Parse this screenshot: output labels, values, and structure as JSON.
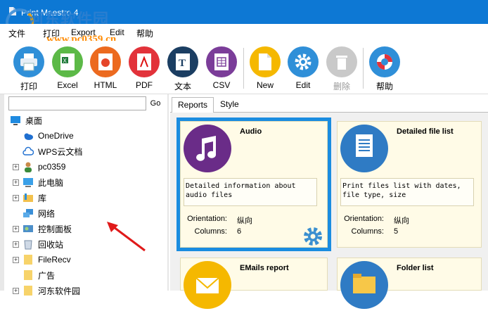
{
  "window": {
    "title": "Print Maestro 4"
  },
  "watermark": {
    "line1": "河东软件园",
    "line2": "www.pc0359.cn"
  },
  "menu": [
    "文件",
    "打印",
    "Export",
    "Edit",
    "帮助"
  ],
  "toolbar": {
    "print": "打印",
    "excel": "Excel",
    "html": "HTML",
    "pdf": "PDF",
    "text": "文本",
    "csv": "CSV",
    "new": "New",
    "edit": "Edit",
    "delete": "删除",
    "help": "帮助"
  },
  "colors": {
    "titlebar": "#0d78d4",
    "selection": "#1a8ce0",
    "card_bg": "#fffbe7"
  },
  "search": {
    "value": "",
    "go_label": "Go"
  },
  "tree": [
    {
      "label": "桌面",
      "icon": "desktop-icon"
    },
    {
      "label": "OneDrive",
      "icon": "cloud-icon"
    },
    {
      "label": "WPS云文档",
      "icon": "cloud-outline-icon"
    },
    {
      "label": "pc0359",
      "icon": "user-icon"
    },
    {
      "label": "此电脑",
      "icon": "computer-icon"
    },
    {
      "label": "库",
      "icon": "library-icon"
    },
    {
      "label": "网络",
      "icon": "network-icon"
    },
    {
      "label": "控制面板",
      "icon": "control-panel-icon"
    },
    {
      "label": "回收站",
      "icon": "recycle-bin-icon"
    },
    {
      "label": "FileRecv",
      "icon": "folder-icon"
    },
    {
      "label": "广告",
      "icon": "folder-icon"
    },
    {
      "label": "河东软件园",
      "icon": "folder-icon"
    }
  ],
  "tabs": [
    "Reports",
    "Style"
  ],
  "reports": [
    {
      "title": "Audio",
      "description": "Detailed information about\naudio files",
      "orientation_label": "Orientation:",
      "orientation": "纵向",
      "columns_label": "Columns:",
      "columns": "6"
    },
    {
      "title": "Detailed file list",
      "description": "Print files list with dates,\nfile type, size",
      "orientation_label": "Orientation:",
      "orientation": "纵向",
      "columns_label": "Columns:",
      "columns": "5"
    },
    {
      "title": "EMails report"
    },
    {
      "title": "Folder list"
    }
  ]
}
